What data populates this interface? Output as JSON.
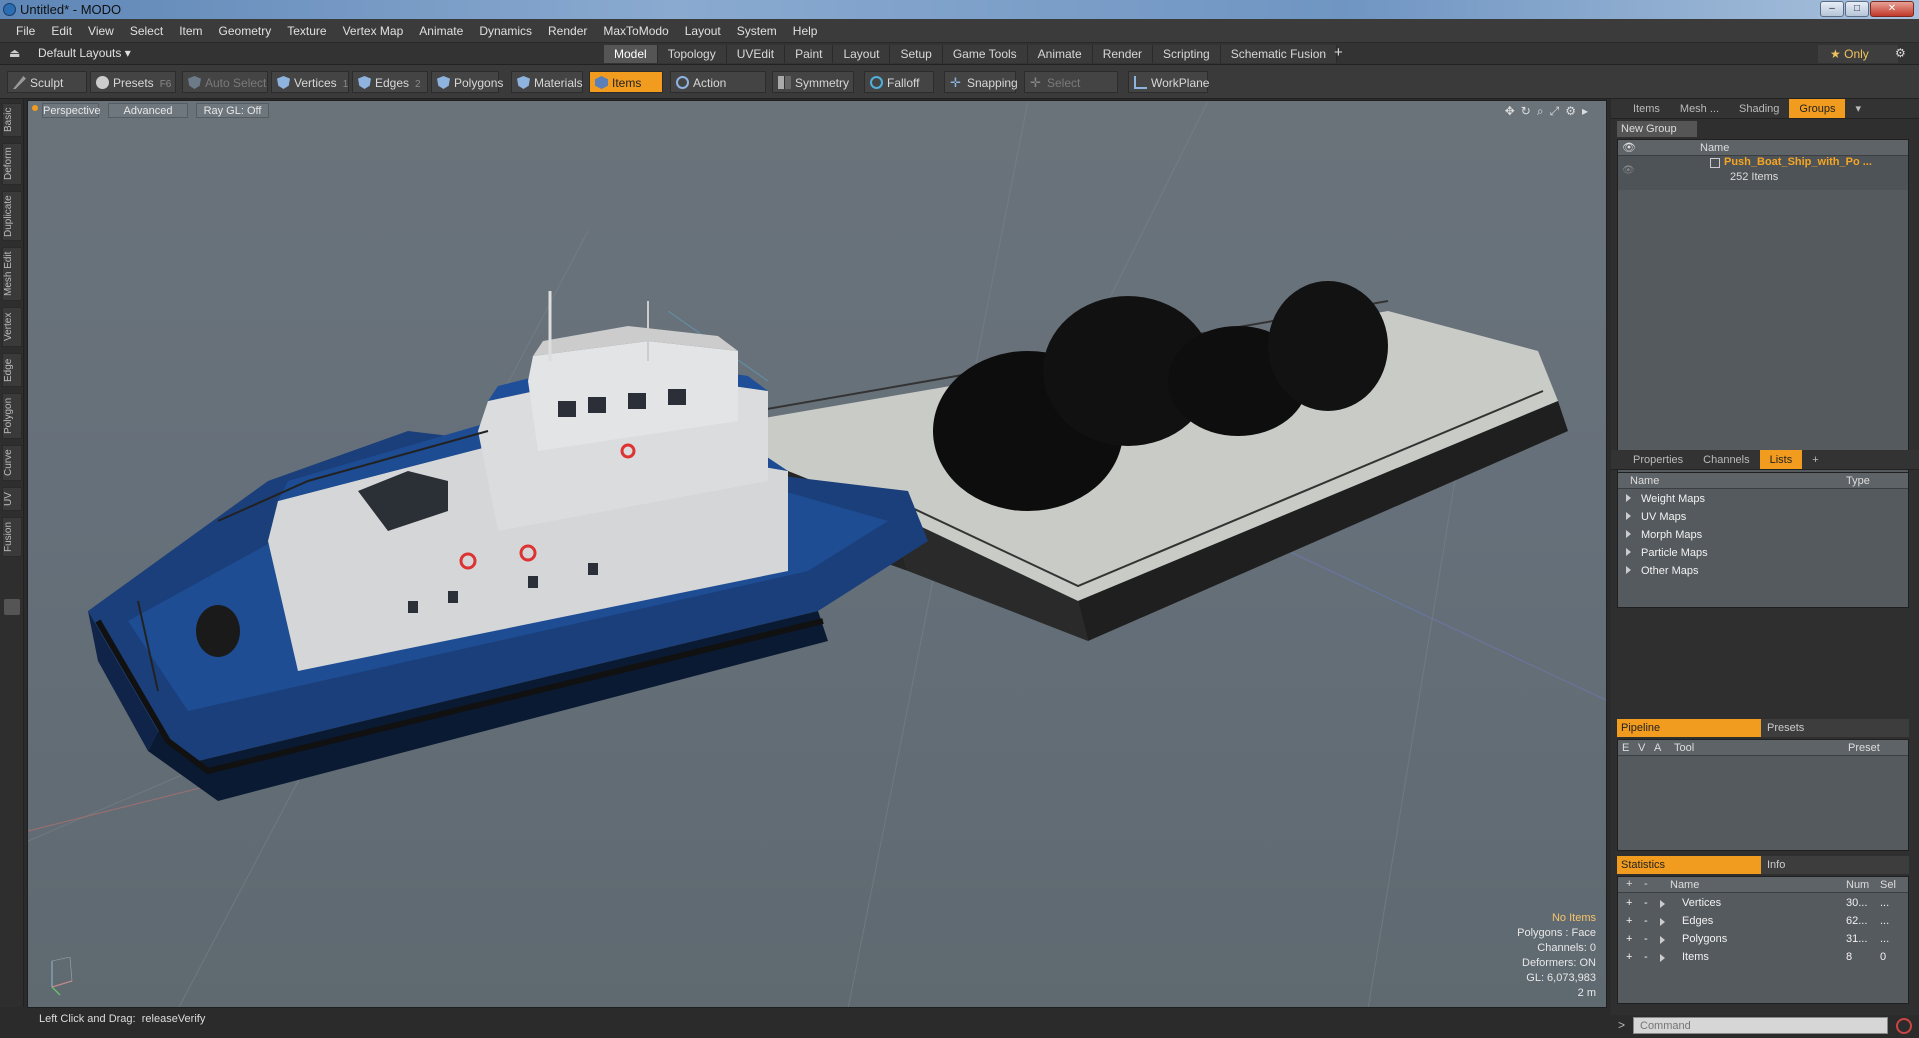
{
  "window": {
    "title": "Untitled* - MODO"
  },
  "menu": [
    "File",
    "Edit",
    "View",
    "Select",
    "Item",
    "Geometry",
    "Texture",
    "Vertex Map",
    "Animate",
    "Dynamics",
    "Render",
    "MaxToModo",
    "Layout",
    "System",
    "Help"
  ],
  "layoutbar": {
    "layout_select": "Default Layouts",
    "tabs": [
      "Model",
      "Topology",
      "UVEdit",
      "Paint",
      "Layout",
      "Setup",
      "Game Tools",
      "Animate",
      "Render",
      "Scripting",
      "Schematic Fusion"
    ],
    "active_tab": "Model",
    "only_label": "Only"
  },
  "toolbar": {
    "sculpt": "Sculpt",
    "presets": "Presets",
    "presets_key": "F6",
    "auto_select": "Auto Select",
    "vertices": "Vertices",
    "vertices_key": "1",
    "edges": "Edges",
    "edges_key": "2",
    "polygons": "Polygons",
    "materials": "Materials",
    "items": "Items",
    "action_center": "Action Center",
    "symmetry": "Symmetry",
    "falloff": "Falloff",
    "snapping": "Snapping",
    "select_through": "Select Through",
    "workplane": "WorkPlane"
  },
  "lefttabs": [
    "Basic",
    "Deform",
    "Duplicate",
    "Mesh Edit",
    "Vertex",
    "Edge",
    "Polygon",
    "Curve",
    "UV",
    "Fusion"
  ],
  "viewport": {
    "view_mode": "Perspective",
    "shading": "Advanced",
    "raygl": "Ray GL: Off",
    "info": {
      "no_items": "No Items",
      "polygons": "Polygons : Face",
      "channels": "Channels: 0",
      "deformers": "Deformers: ON",
      "gl": "GL: 6,073,983",
      "scale": "2 m"
    }
  },
  "status": {
    "left": "Left Click and Drag:",
    "action": "releaseVerify"
  },
  "groups_panel": {
    "tabs": [
      "Items",
      "Mesh ...",
      "Shading",
      "Groups"
    ],
    "active": "Groups",
    "new_group": "New Group",
    "col_name": "Name",
    "group_name": "Push_Boat_Ship_with_Po ...",
    "group_count": "252 Items"
  },
  "lists_panel": {
    "tabs": [
      "Properties",
      "Channels",
      "Lists"
    ],
    "active": "Lists",
    "col_name": "Name",
    "col_type": "Type",
    "items": [
      "Weight Maps",
      "UV Maps",
      "Morph Maps",
      "Particle Maps",
      "Other Maps"
    ]
  },
  "pipeline_panel": {
    "tab_on": "Pipeline",
    "tab_off": "Presets",
    "cols": [
      "E",
      "V",
      "A",
      "Tool",
      "Preset"
    ]
  },
  "stats_panel": {
    "tab_on": "Statistics",
    "tab_off": "Info",
    "cols": {
      "name": "Name",
      "num": "Num",
      "sel": "Sel"
    },
    "rows": [
      {
        "name": "Vertices",
        "num": "30...",
        "sel": "..."
      },
      {
        "name": "Edges",
        "num": "62...",
        "sel": "..."
      },
      {
        "name": "Polygons",
        "num": "31...",
        "sel": "..."
      },
      {
        "name": "Items",
        "num": "8",
        "sel": "0"
      }
    ]
  },
  "command": {
    "placeholder": "Command"
  }
}
